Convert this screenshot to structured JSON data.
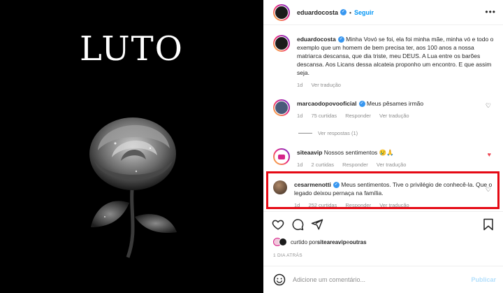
{
  "photo": {
    "title": "LUTO"
  },
  "header": {
    "username": "eduardocosta",
    "separator": "•",
    "follow_label": "Seguir",
    "more_icon": "more-horizontal-icon"
  },
  "caption": {
    "username": "eduardocosta",
    "text": "Minha Vovó se foi, ela foi minha mãe, minha vó e todo o exemplo que um homem de bem precisa ter, aos 100 anos a nossa matriarca descansa, que dia triste, meu DEUS. A Lua entre os barões descansa. Aos Licans dessa alcateia proponho um encontro. E que assim seja.",
    "time": "1d",
    "translate": "Ver tradução"
  },
  "comments": [
    {
      "username": "marcaodopovooficial",
      "verified": true,
      "text": "Meus pêsames irmão",
      "time": "1d",
      "likes": "75 curtidas",
      "reply": "Responder",
      "translate": "Ver tradução",
      "liked": false
    },
    {
      "username": "siteaavip",
      "verified": false,
      "text": "Nossos sentimentos 😢🙏",
      "time": "1d",
      "likes": "2 curtidas",
      "reply": "Responder",
      "translate": "Ver tradução",
      "liked": true
    },
    {
      "username": "cesarmenotti",
      "verified": true,
      "text": "Meus sentimentos. Tive o privilégio de conhecê-la. Que o legado deixou pernaça na família.",
      "time": "1d",
      "likes": "252 curtidas",
      "reply": "Responder",
      "translate": "Ver tradução",
      "liked": false
    }
  ],
  "see_replies": "Ver respostas (1)",
  "likes_line": {
    "prefix": "curtido por ",
    "user": "siteareavip",
    "connector": " e ",
    "others": "outras"
  },
  "when": "1 DIA ATRÁS",
  "add_comment": {
    "placeholder": "Adicione um comentário...",
    "publish": "Publicar"
  },
  "colors": {
    "accent": "#0095f6",
    "verified": "#3897f0",
    "liked": "#ed4956",
    "highlight": "#e50914"
  }
}
